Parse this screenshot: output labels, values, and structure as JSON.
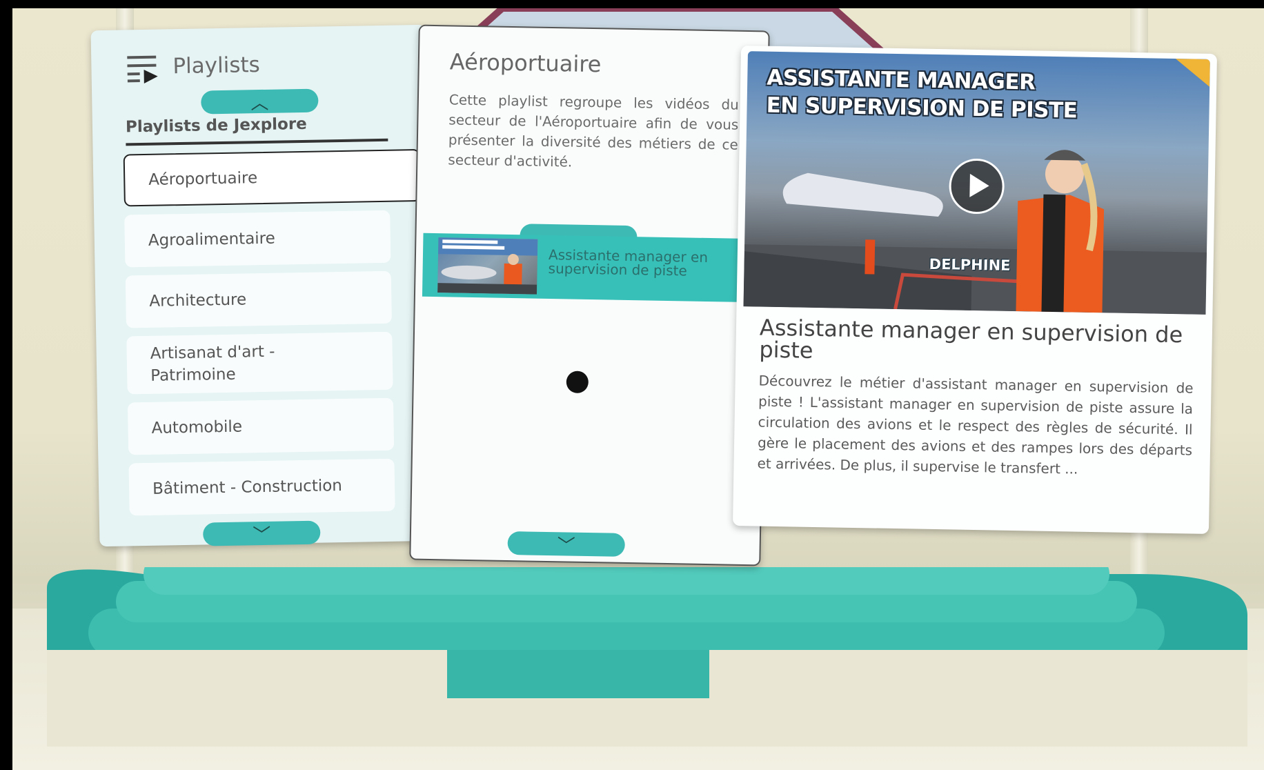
{
  "playlists_panel": {
    "header_title": "Playlists",
    "section_title": "Playlists de Jexplore",
    "scroll_up_glyph": "︿",
    "scroll_down_glyph": "﹀",
    "items": [
      {
        "label": "Aéroportuaire",
        "selected": true
      },
      {
        "label": "Agroalimentaire",
        "selected": false
      },
      {
        "label": "Architecture",
        "selected": false
      },
      {
        "label": "Artisanat d'art - Patrimoine",
        "selected": false
      },
      {
        "label": "Automobile",
        "selected": false
      },
      {
        "label": "Bâtiment - Construction",
        "selected": false
      }
    ]
  },
  "playlist_detail": {
    "title": "Aéroportuaire",
    "description": "Cette playlist regroupe les vidéos du secteur de l'Aéroportuaire afin de vous présenter la diversité des métiers de ce secteur d'activité.",
    "scroll_up_glyph": "︿",
    "scroll_down_glyph": "﹀",
    "videos": [
      {
        "label": "Assistante manager en supervision de piste"
      }
    ]
  },
  "video_detail": {
    "thumbnail_line1": "ASSISTANTE MANAGER",
    "thumbnail_line2": "EN SUPERVISION DE PISTE",
    "thumbnail_name": "DELPHINE",
    "title": "Assistante manager en supervision de piste",
    "description": "Découvrez le métier d'assistant manager en supervision de piste ! L'assistant manager en supervision de piste assure la circulation des avions et le respect des règles de sécurité. Il gère le placement des avions et des rampes lors des départs et arrivées. De plus, il supervise le transfert ..."
  },
  "icons": {
    "playlist": "playlist-icon",
    "play": "play-icon",
    "cursor": "pointer-dot"
  },
  "colors": {
    "accent": "#3ebab4",
    "podium": "#46bfae",
    "panel_bg": "#e6f4f4"
  }
}
